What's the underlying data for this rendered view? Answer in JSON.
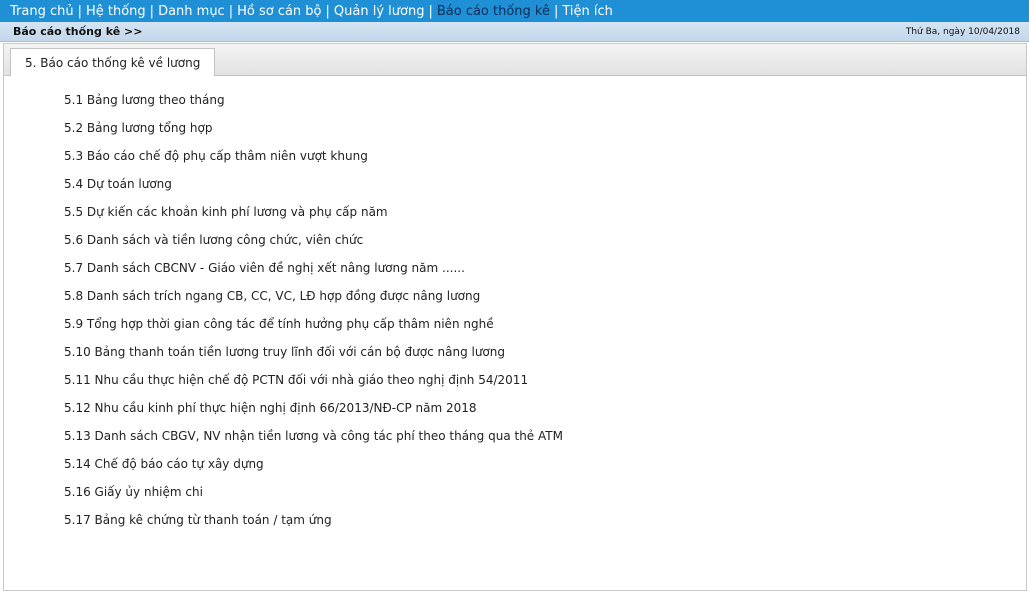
{
  "nav": {
    "items": [
      "Trang chủ",
      "Hệ thống",
      "Danh mục",
      "Hồ sơ cán bộ",
      "Quản lý lương",
      "Báo cáo thống kê",
      "Tiện ích"
    ],
    "active_index": 5,
    "separator": "|"
  },
  "subbar": {
    "breadcrumb": "Báo cáo thống kê >>",
    "date": "Thứ Ba, ngày 10/04/2018"
  },
  "tab": {
    "label": "5. Báo cáo thống kê về lương"
  },
  "reports": [
    "5.1 Bảng lương theo tháng",
    "5.2 Bảng lương tổng hợp",
    "5.3 Báo cáo chế độ phụ cấp thâm niên vượt khung",
    "5.4 Dự toán lương",
    "5.5 Dự kiến các khoản kinh phí lương và phụ cấp năm",
    "5.6 Danh sách và tiền lương công chức, viên chức",
    "5.7 Danh sách CBCNV - Giáo viên đề nghị xết nâng lương năm ......",
    "5.8 Danh sách trích ngang CB, CC, VC, LĐ hợp đồng được nâng lương",
    "5.9 Tổng hợp thời gian công tác để tính hưởng phụ cấp thâm niên nghề",
    "5.10 Bảng thanh toán tiền lương truy lĩnh đối với cán bộ được nâng lương",
    "5.11 Nhu cầu thực hiện chế độ PCTN đối với nhà giáo theo nghị định 54/2011",
    "5.12 Nhu cầu kinh phí thực hiện nghị định 66/2013/NĐ-CP năm 2018",
    "5.13 Danh sách CBGV, NV nhận tiền lương và công tác phí theo tháng qua thẻ ATM",
    "5.14 Chế độ báo cáo tự xây dựng",
    "5.16 Giấy ủy nhiệm chi",
    "5.17 Bảng kê chứng từ thanh toán / tạm ứng"
  ]
}
